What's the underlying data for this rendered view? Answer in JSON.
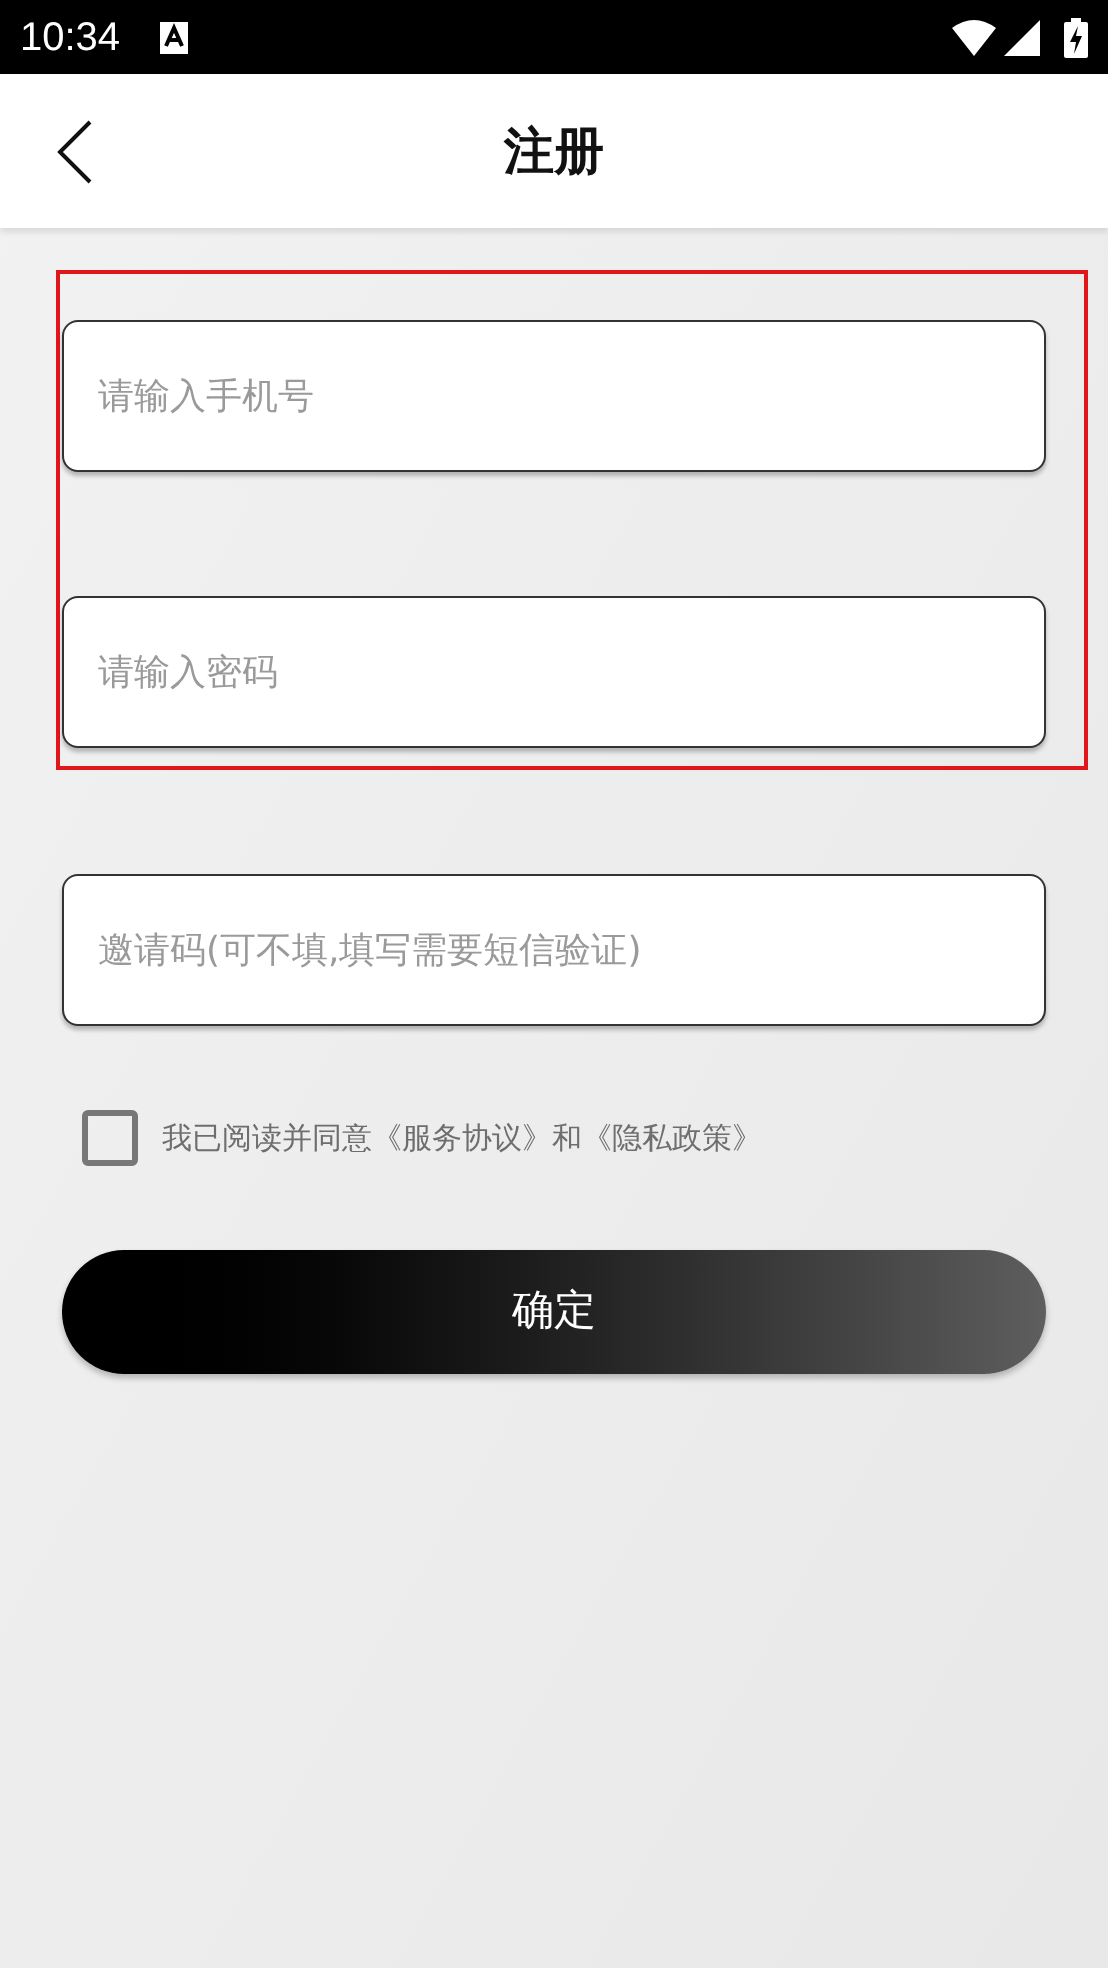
{
  "status_bar": {
    "time": "10:34"
  },
  "header": {
    "title": "注册"
  },
  "fields": [
    {
      "placeholder": "请输入手机号",
      "highlighted": true
    },
    {
      "placeholder": "请输入密码",
      "highlighted": true
    },
    {
      "placeholder": "邀请码(可不填,填写需要短信验证)",
      "highlighted": false
    }
  ],
  "agreement": {
    "text": "我已阅读并同意《服务协议》和《隐私政策》",
    "checked": false
  },
  "submit_button": "确定"
}
